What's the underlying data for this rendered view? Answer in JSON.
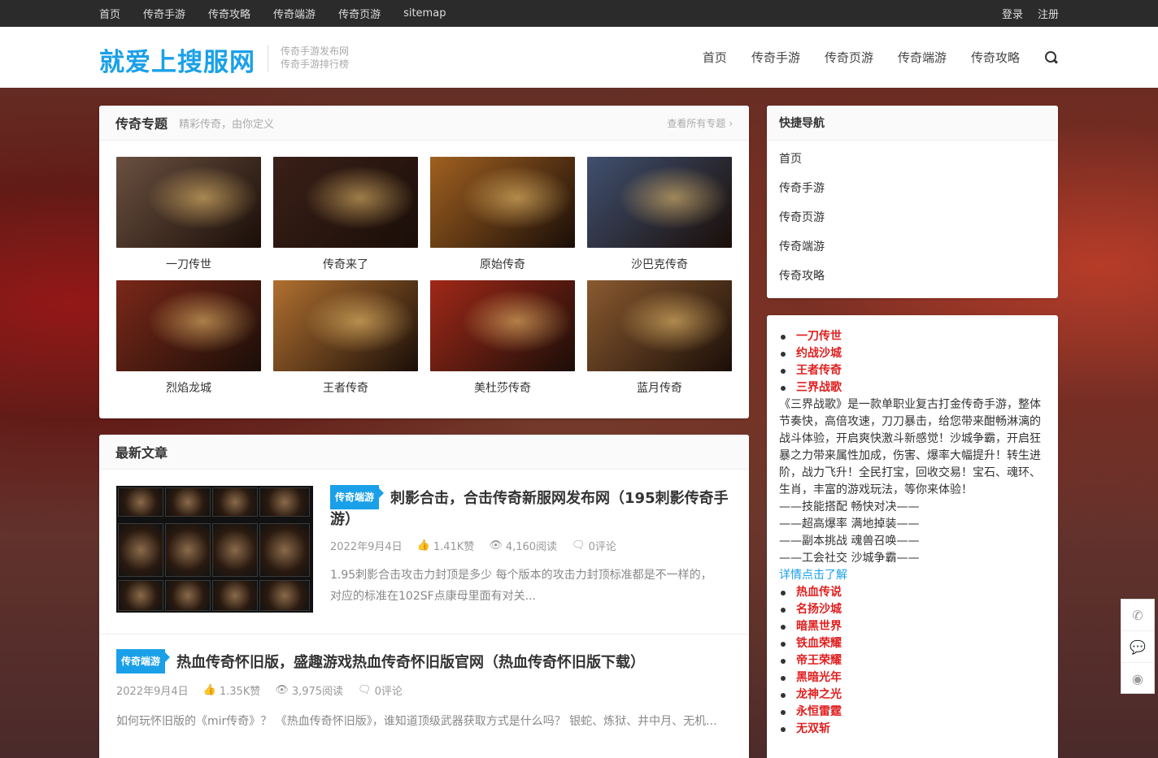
{
  "topbar": {
    "nav": [
      "首页",
      "传奇手游",
      "传奇攻略",
      "传奇端游",
      "传奇页游",
      "sitemap"
    ],
    "login": "登录",
    "register": "注册"
  },
  "header": {
    "logo": "就爱上搜服网",
    "tagline1": "传奇手游发布网",
    "tagline2": "传奇手游排行榜",
    "nav": [
      "首页",
      "传奇手游",
      "传奇页游",
      "传奇端游",
      "传奇攻略"
    ],
    "search_icon": "search-icon"
  },
  "topics": {
    "title": "传奇专题",
    "subtitle": "精彩传奇，由你定义",
    "more": "查看所有专题 ›",
    "items": [
      {
        "label": "一刀传世",
        "color": "#6a5040"
      },
      {
        "label": "传奇来了",
        "color": "#3a2018"
      },
      {
        "label": "原始传奇",
        "color": "#a06020"
      },
      {
        "label": "沙巴克传奇",
        "color": "#405070"
      },
      {
        "label": "烈焰龙城",
        "color": "#7a2818"
      },
      {
        "label": "王者传奇",
        "color": "#b07030"
      },
      {
        "label": "美杜莎传奇",
        "color": "#a02818"
      },
      {
        "label": "蓝月传奇",
        "color": "#8a5a30"
      }
    ]
  },
  "articles": {
    "title": "最新文章",
    "items": [
      {
        "badge": "传奇端游",
        "title": "刺影合击，合击传奇新服网发布网（195刺影传奇手游）",
        "date": "2022年9月4日",
        "likes": "1.41K赞",
        "views": "4,160阅读",
        "comments": "0评论",
        "excerpt": "1.95刺影合击攻击力封顶是多少 每个版本的攻击力封顶标准都是不一样的，对应的标准在102SF点康母里面有对关..."
      },
      {
        "badge": "传奇端游",
        "title": "热血传奇怀旧版，盛趣游戏热血传奇怀旧版官网（热血传奇怀旧版下载）",
        "date": "2022年9月4日",
        "likes": "1.35K赞",
        "views": "3,975阅读",
        "comments": "0评论",
        "excerpt": "如何玩怀旧版的《mir传奇》？ 《热血传奇怀旧版》，谁知道顶级武器获取方式是什么吗？ 银蛇、炼狱、井中月、无机..."
      }
    ]
  },
  "quicknav": {
    "title": "快捷导航",
    "items": [
      "首页",
      "传奇手游",
      "传奇页游",
      "传奇端游",
      "传奇攻略"
    ]
  },
  "promo": {
    "top_items": [
      "一刀传世",
      "约战沙城",
      "王者传奇",
      "三界战歌"
    ],
    "desc": "《三界战歌》是一款单职业复古打金传奇手游，整体节奏快，高倍攻速，刀刀暴击，给您带来酣畅淋漓的战斗体验，开启爽快激斗新感觉！沙城争霸，开启狂暴之力带来属性加成，伤害、爆率大幅提升！转生进阶，战力飞升！全民打宝，回收交易！宝石、魂环、生肖，丰富的游戏玩法，等你来体验！",
    "lines": [
      "——技能搭配 畅快对决——",
      "——超高爆率 满地掉装——",
      "——副本挑战 魂兽召唤——",
      "——工会社交 沙城争霸——"
    ],
    "link": "详情点击了解",
    "bottom_items": [
      "热血传说",
      "名扬沙城",
      "暗黑世界",
      "铁血荣耀",
      "帝王荣耀",
      "黑暗光年",
      "龙神之光",
      "永恒雷霆",
      "无双斩"
    ]
  },
  "float": {
    "icons": [
      "phone-icon",
      "wechat-icon",
      "weibo-icon"
    ]
  }
}
